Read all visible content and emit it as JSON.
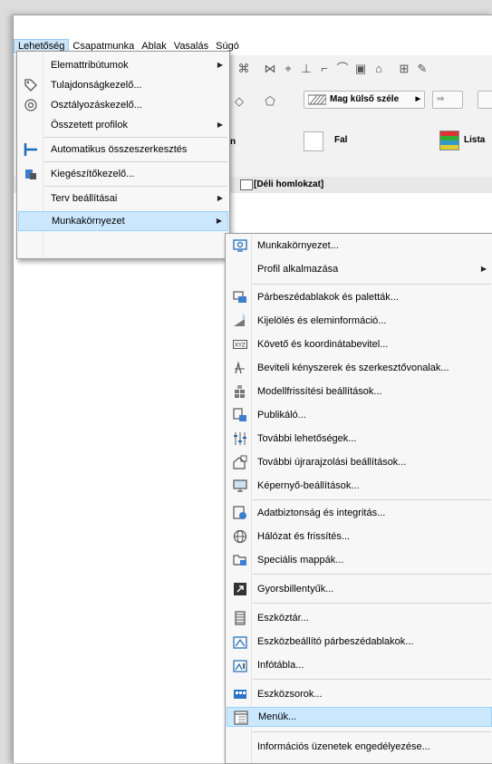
{
  "menubar": {
    "items": [
      "Lehetőség",
      "Csapatmunka",
      "Ablak",
      "Vasalás",
      "Súgó"
    ]
  },
  "toolbar": {
    "line_style_label": "Mag külső széle",
    "wall_label": "Fal",
    "list_label": "Lista",
    "partial_label": "n"
  },
  "tab": {
    "label": "[Déli homlokzat]"
  },
  "menu1": {
    "items": [
      {
        "label": "Elemattribútumok",
        "icon": "none",
        "submenu": true
      },
      {
        "label": "Tulajdonságkezelő...",
        "icon": "tag-icon",
        "submenu": false
      },
      {
        "label": "Osztályozáskezelő...",
        "icon": "classification-icon",
        "submenu": false
      },
      {
        "label": "Összetett profilok",
        "icon": "none",
        "submenu": true
      },
      {
        "label": "Automatikus összeszerkesztés",
        "icon": "auto-join-icon",
        "submenu": false
      },
      {
        "label": "Kiegészítőkezelő...",
        "icon": "addon-icon",
        "submenu": false
      },
      {
        "label": "Terv beállításai",
        "icon": "none",
        "submenu": true
      },
      {
        "label": "Munkakörnyezet",
        "icon": "none",
        "submenu": true
      }
    ]
  },
  "menu2": {
    "items": [
      {
        "label": "Munkakörnyezet...",
        "icon": "work-environment-icon",
        "submenu": false
      },
      {
        "label": "Profil alkalmazása",
        "icon": "none",
        "submenu": true
      },
      {
        "label": "Párbeszédablakok és paletták...",
        "icon": "dialogs-icon",
        "submenu": false
      },
      {
        "label": "Kijelölés és eleminformáció...",
        "icon": "selection-icon",
        "submenu": false
      },
      {
        "label": "Követő és koordinátabevitel...",
        "icon": "xyz-icon",
        "submenu": false
      },
      {
        "label": "Beviteli kényszerek és szerkesztővonalak...",
        "icon": "constraint-icon",
        "submenu": false
      },
      {
        "label": "Modellfrissítési beállítások...",
        "icon": "model-rebuild-icon",
        "submenu": false
      },
      {
        "label": "Publikáló...",
        "icon": "publisher-icon",
        "submenu": false
      },
      {
        "label": "További lehetőségek...",
        "icon": "more-options-icon",
        "submenu": false
      },
      {
        "label": "További újrarajzolási beállítások...",
        "icon": "redraw-icon",
        "submenu": false
      },
      {
        "label": "Képernyő-beállítások...",
        "icon": "screen-icon",
        "submenu": false
      },
      {
        "label": "Adatbiztonság és integritás...",
        "icon": "data-safety-icon",
        "submenu": false
      },
      {
        "label": "Hálózat és frissítés...",
        "icon": "network-icon",
        "submenu": false
      },
      {
        "label": "Speciális mappák...",
        "icon": "folder-icon",
        "submenu": false
      },
      {
        "label": "Gyorsbillentyűk...",
        "icon": "shortcut-icon",
        "submenu": false
      },
      {
        "label": "Eszköztár...",
        "icon": "toolbox-icon",
        "submenu": false
      },
      {
        "label": "Eszközbeállító párbeszédablakok...",
        "icon": "tool-settings-icon",
        "submenu": false
      },
      {
        "label": "Infótábla...",
        "icon": "info-box-icon",
        "submenu": false
      },
      {
        "label": "Eszközsorok...",
        "icon": "toolbars-icon",
        "submenu": false
      },
      {
        "label": "Menük...",
        "icon": "menus-icon",
        "submenu": false
      },
      {
        "label": "Információs üzenetek engedélyezése...",
        "icon": "none",
        "submenu": false
      }
    ]
  },
  "colors": {
    "highlight": "#cce8ff",
    "highlight_border": "#99d1ff",
    "menu_bg": "#f7f7f7",
    "accent_blue": "#1e6bb8"
  }
}
